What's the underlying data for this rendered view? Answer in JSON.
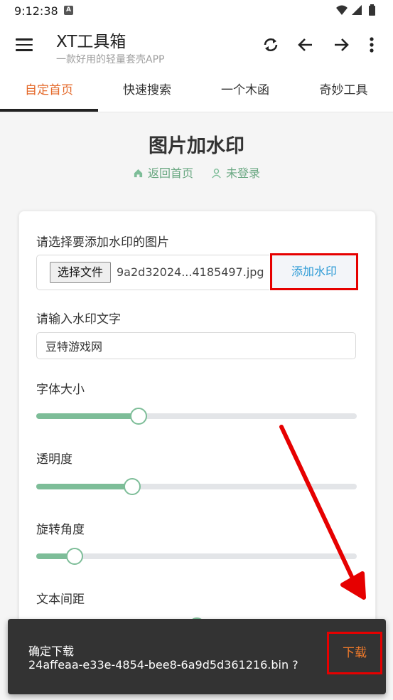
{
  "status_bar": {
    "time": "9:12:38",
    "notification_badge": "A"
  },
  "app": {
    "title": "XT工具箱",
    "subtitle": "一款好用的轻量套壳APP"
  },
  "toolbar_icons": [
    "refresh-icon",
    "arrow-left-icon",
    "arrow-right-icon",
    "more-vert-icon"
  ],
  "tabs": [
    {
      "label": "自定首页",
      "active": true
    },
    {
      "label": "快速搜索",
      "active": false
    },
    {
      "label": "一个木函",
      "active": false
    },
    {
      "label": "奇妙工具",
      "active": false
    }
  ],
  "page": {
    "title": "图片加水印",
    "back_home": "返回首页",
    "login": "未登录"
  },
  "form": {
    "image_label": "请选择要添加水印的图片",
    "choose_file": "选择文件",
    "file_name": "9a2d32024...4185497.jpg",
    "add_watermark": "添加水印",
    "text_label": "请输入水印文字",
    "text_value": "豆特游戏网",
    "sliders": [
      {
        "label": "字体大小",
        "value_percent": 32
      },
      {
        "label": "透明度",
        "value_percent": 30
      },
      {
        "label": "旋转角度",
        "value_percent": 12
      },
      {
        "label": "文本间距",
        "value_percent": 50
      }
    ]
  },
  "snackbar": {
    "line1": "确定下载",
    "line2": "24affeaa-e33e-4854-bee8-6a9d5d361216.bin ?",
    "action": "下载"
  },
  "colors": {
    "accent": "#e4692a",
    "green": "#7dbd98",
    "highlight_red": "#e60000",
    "link_blue": "#2e9bd6"
  }
}
